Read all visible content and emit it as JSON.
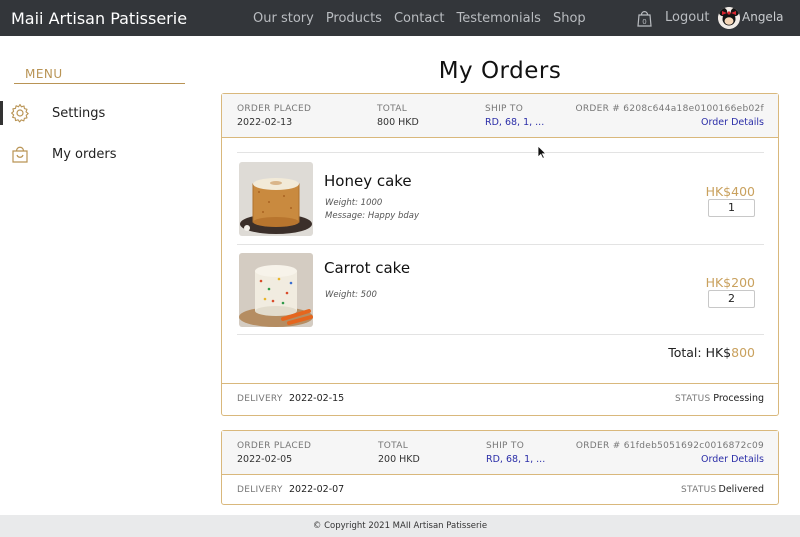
{
  "brand": "Maii Artisan Patisserie",
  "nav": [
    "Our story",
    "Products",
    "Contact",
    "Testemonials",
    "Shop"
  ],
  "user": {
    "logout": "Logout",
    "name": "Angela"
  },
  "sidebar": {
    "menu_title": "MENU",
    "items": [
      {
        "label": "Settings",
        "icon": "gear-icon"
      },
      {
        "label": "My orders",
        "icon": "shopping-bag-icon"
      }
    ]
  },
  "page_title": "My Orders",
  "orders": [
    {
      "placed_label": "ORDER PLACED",
      "placed": "2022-02-13",
      "total_label": "TOTAL",
      "total": "800 HKD",
      "ship_label": "SHIP TO",
      "ship": "RD, 68, 1, ...",
      "number_label": "ORDER # 6208c644a18e0100166eb02f",
      "details_link": "Order Details",
      "items": [
        {
          "name": "Honey cake",
          "weight": "Weight: 1000",
          "message": "Message: Happy bday",
          "price": "HK$400",
          "qty": "1"
        },
        {
          "name": "Carrot cake",
          "weight": "Weight: 500",
          "price": "HK$200",
          "qty": "2"
        }
      ],
      "grand_total_label": "Total: HK$",
      "grand_total": "800",
      "delivery_label": "DELIVERY",
      "delivery": "2022-02-15",
      "status_label": "STATUS",
      "status": "Processing"
    },
    {
      "placed_label": "ORDER PLACED",
      "placed": "2022-02-05",
      "total_label": "TOTAL",
      "total": "200 HKD",
      "ship_label": "SHIP TO",
      "ship": "RD, 68, 1, ...",
      "number_label": "ORDER # 61fdeb5051692c0016872c09",
      "details_link": "Order Details",
      "delivery_label": "DELIVERY",
      "delivery": "2022-02-07",
      "status_label": "STATUS",
      "status": "Delivered"
    }
  ],
  "footer": "© Copyright 2021 MAII Artisan Patisserie",
  "colors": {
    "navbar": "#33363a",
    "accent": "#c9a15e",
    "border": "#d9b87c",
    "link": "#2b2ea8"
  }
}
